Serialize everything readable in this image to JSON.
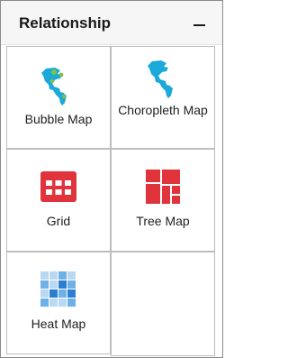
{
  "panel": {
    "title": "Relationship",
    "collapse_icon": "minus-icon"
  },
  "items": [
    {
      "label": "Bubble Map",
      "icon": "bubble-map-icon"
    },
    {
      "label": "Choropleth Map",
      "icon": "choropleth-map-icon"
    },
    {
      "label": "Grid",
      "icon": "grid-icon"
    },
    {
      "label": "Tree Map",
      "icon": "tree-map-icon"
    },
    {
      "label": "Heat Map",
      "icon": "heat-map-icon"
    }
  ],
  "colors": {
    "map_cyan": "#1aa9d9",
    "bubble_green": "#7dc242",
    "grid_red": "#e0333c",
    "heat_light": "#b9d9f3",
    "heat_mid": "#6fb1e6",
    "heat_dark": "#2c7fd0"
  }
}
